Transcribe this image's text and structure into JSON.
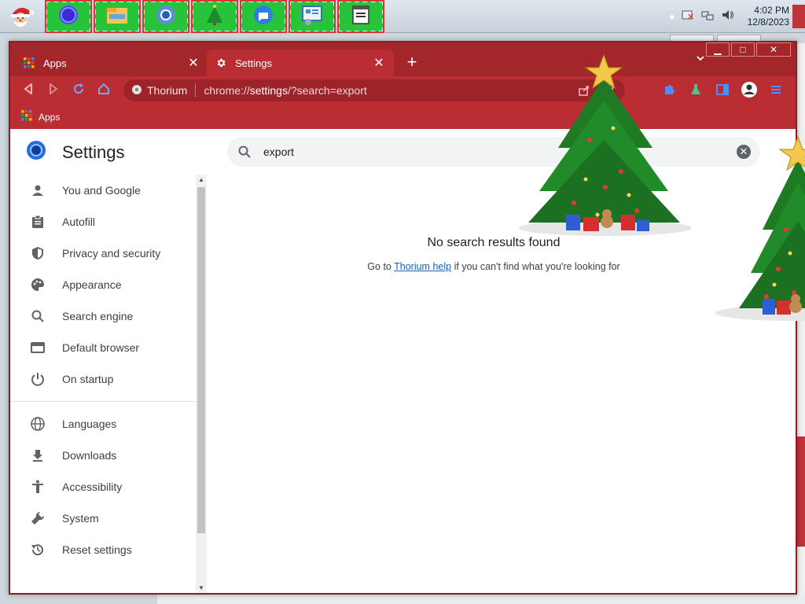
{
  "taskbar": {
    "clock_time": "4:02 PM",
    "clock_date": "12/8/2023",
    "pinned": [
      "browser-icon",
      "file-explorer-icon",
      "chromium-icon",
      "christmas-tree-icon",
      "chat-icon",
      "control-panel-icon",
      "notepad-icon"
    ]
  },
  "browser": {
    "tabs": [
      {
        "label": "Apps",
        "active": false
      },
      {
        "label": "Settings",
        "active": true
      }
    ],
    "omnibox": {
      "site_name": "Thorium",
      "url_prefix": "chrome://",
      "url_host": "settings",
      "url_rest": "/?search=export"
    },
    "bookmarks": [
      {
        "label": "Apps"
      }
    ],
    "colors": {
      "frame": "#a3262b",
      "toolbar": "#b92d33",
      "accent": "#1a73e8"
    }
  },
  "settings": {
    "title": "Settings",
    "search_value": "export",
    "nav": [
      {
        "label": "You and Google",
        "icon": "person-icon"
      },
      {
        "label": "Autofill",
        "icon": "clipboard-icon"
      },
      {
        "label": "Privacy and security",
        "icon": "shield-icon"
      },
      {
        "label": "Appearance",
        "icon": "palette-icon"
      },
      {
        "label": "Search engine",
        "icon": "search-icon"
      },
      {
        "label": "Default browser",
        "icon": "browser-window-icon"
      },
      {
        "label": "On startup",
        "icon": "power-icon"
      },
      {
        "label": "Languages",
        "icon": "globe-icon"
      },
      {
        "label": "Downloads",
        "icon": "download-icon"
      },
      {
        "label": "Accessibility",
        "icon": "accessibility-icon"
      },
      {
        "label": "System",
        "icon": "wrench-icon"
      },
      {
        "label": "Reset settings",
        "icon": "reset-icon"
      }
    ],
    "results": {
      "heading": "No search results found",
      "help_prefix": "Go to",
      "help_link": "Thorium help",
      "help_suffix": "if you can't find what you're looking for"
    }
  }
}
